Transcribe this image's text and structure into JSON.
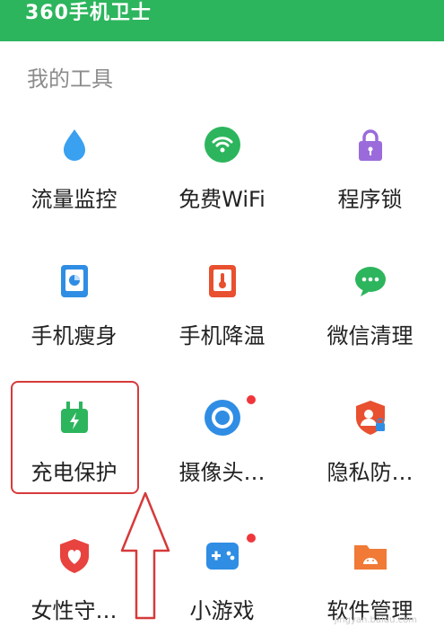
{
  "header": {
    "brand": "360手机卫士",
    "bg_color": "#2db55d"
  },
  "section": {
    "title": "我的工具"
  },
  "tools": [
    {
      "label": "流量监控",
      "icon": "water-drop-icon"
    },
    {
      "label": "免费WiFi",
      "icon": "wifi-icon"
    },
    {
      "label": "程序锁",
      "icon": "lock-icon"
    },
    {
      "label": "手机瘦身",
      "icon": "phone-slim-icon"
    },
    {
      "label": "手机降温",
      "icon": "phone-cool-icon"
    },
    {
      "label": "微信清理",
      "icon": "wechat-icon"
    },
    {
      "label": "充电保护",
      "icon": "charger-icon"
    },
    {
      "label": "摄像头…",
      "icon": "camera-icon",
      "badge": true
    },
    {
      "label": "隐私防…",
      "icon": "privacy-shield-icon"
    },
    {
      "label": "女性守…",
      "icon": "heart-shield-icon"
    },
    {
      "label": "小游戏",
      "icon": "gamepad-icon",
      "badge": true
    },
    {
      "label": "软件管理",
      "icon": "android-folder-icon"
    }
  ],
  "watermark": "jingyan.baidu.com",
  "colors": {
    "accent": "#2db55d",
    "highlight": "#d63a3a",
    "badge": "#f0363b"
  }
}
